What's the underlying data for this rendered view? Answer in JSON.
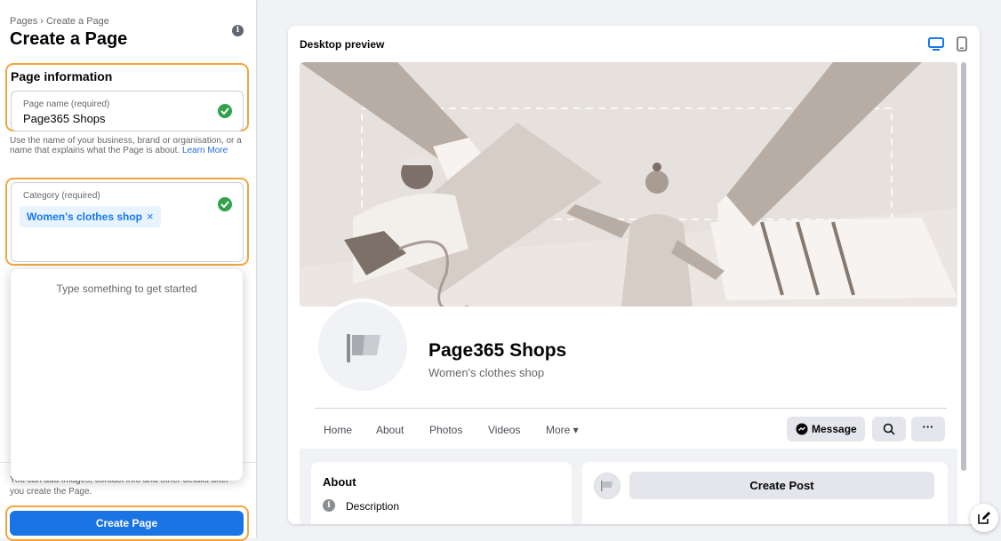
{
  "sidebar": {
    "breadcrumb": "Pages › Create a Page",
    "title": "Create a Page",
    "section_title": "Page information",
    "page_name": {
      "label": "Page name (required)",
      "value": "Page365 Shops"
    },
    "help_text": "Use the name of your business, brand or organisation, or a name that explains what the Page is about.",
    "help_link": "Learn More",
    "category": {
      "label": "Category (required)",
      "chip": "Women's clothes shop",
      "chip_remove": "×"
    },
    "dropdown_hint": "Type something to get started",
    "footer_note": "You can add images, contact info and other details after you create the Page.",
    "create_button": "Create Page"
  },
  "preview": {
    "title": "Desktop preview",
    "page_name": "Page365 Shops",
    "category": "Women's clothes shop",
    "tabs": [
      "Home",
      "About",
      "Photos",
      "Videos",
      "More ▾"
    ],
    "message_button": "Message",
    "more_actions": "···",
    "about_title": "About",
    "description_label": "Description",
    "create_post": "Create Post"
  },
  "icons": [
    "info-icon",
    "check-icon",
    "close-icon",
    "desktop-icon",
    "mobile-icon",
    "flag-icon",
    "messenger-icon",
    "search-icon",
    "edit-icon"
  ],
  "colors": {
    "accent": "#1b74e4",
    "highlight": "#f4a53c",
    "success": "#31a24c"
  }
}
